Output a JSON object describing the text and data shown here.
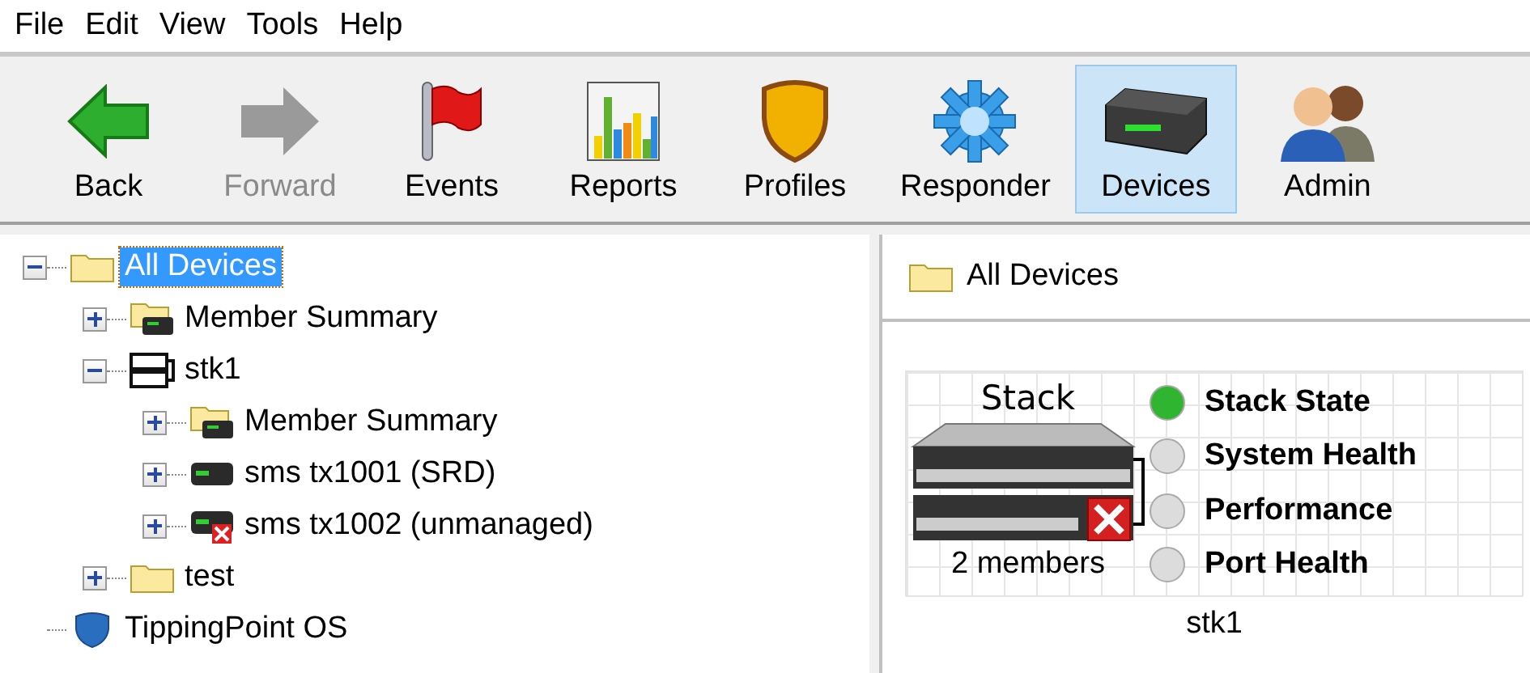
{
  "menu": [
    "File",
    "Edit",
    "View",
    "Tools",
    "Help"
  ],
  "toolbar": [
    {
      "label": "Back",
      "kind": "back",
      "disabled": false,
      "selected": false
    },
    {
      "label": "Forward",
      "kind": "forward",
      "disabled": true,
      "selected": false
    },
    {
      "label": "Events",
      "kind": "events",
      "disabled": false,
      "selected": false
    },
    {
      "label": "Reports",
      "kind": "reports",
      "disabled": false,
      "selected": false
    },
    {
      "label": "Profiles",
      "kind": "profiles",
      "disabled": false,
      "selected": false
    },
    {
      "label": "Responder",
      "kind": "responder",
      "disabled": false,
      "selected": false
    },
    {
      "label": "Devices",
      "kind": "devices",
      "disabled": false,
      "selected": true
    },
    {
      "label": "Admin",
      "kind": "admin",
      "disabled": false,
      "selected": false
    }
  ],
  "tree": [
    {
      "label": "All Devices",
      "kind": "folder",
      "expanded": true,
      "selected": true,
      "children": [
        {
          "label": "Member Summary",
          "kind": "member-folder",
          "expanded": false,
          "selected": false
        },
        {
          "label": "stk1",
          "kind": "stack",
          "expanded": true,
          "selected": false,
          "children": [
            {
              "label": "Member Summary",
              "kind": "member-folder",
              "expanded": false,
              "selected": false
            },
            {
              "label": "sms tx1001 (SRD)",
              "kind": "device",
              "expanded": false,
              "selected": false
            },
            {
              "label": "sms tx1002 (unmanaged)",
              "kind": "device-error",
              "expanded": false,
              "selected": false
            }
          ]
        },
        {
          "label": "test",
          "kind": "folder",
          "expanded": false,
          "selected": false
        }
      ]
    },
    {
      "label": "TippingPoint OS",
      "kind": "os",
      "selected": false
    }
  ],
  "panel": {
    "title": "All Devices",
    "stack_card": {
      "heading": "Stack",
      "members": "2 members",
      "name": "stk1",
      "statuses": [
        {
          "label": "Stack State",
          "color": "#2fb52f"
        },
        {
          "label": "System Health",
          "color": "#dcdcdc"
        },
        {
          "label": "Performance",
          "color": "#dcdcdc"
        },
        {
          "label": "Port Health",
          "color": "#dcdcdc"
        }
      ]
    }
  }
}
